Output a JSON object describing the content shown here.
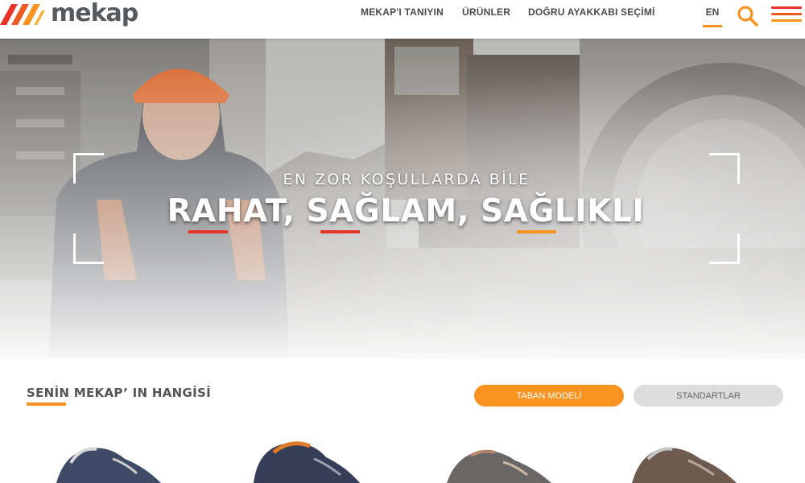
{
  "brand": {
    "name": "mekap",
    "colors": {
      "orange": "#f7931e",
      "red": "#e8332a",
      "grey": "#555a5f"
    }
  },
  "nav": {
    "items": [
      {
        "label": "MEKAP'I TANIYIN"
      },
      {
        "label": "ÜRÜNLER"
      },
      {
        "label": "DOĞRU AYAKKABI SEÇİMİ"
      }
    ],
    "language": "EN",
    "icons": {
      "search": "search-icon",
      "menu": "hamburger-menu-icon"
    }
  },
  "hero": {
    "subtitle": "EN ZOR KOŞULLARDA BİLE",
    "title": "RAHAT, SAĞLAM, SAĞLIKLI",
    "underline_colors": [
      "#e8332a",
      "#e8332a",
      "#f7931e"
    ]
  },
  "section": {
    "title": "SENİN MEKAP’ IN HANGİSİ",
    "buttons": {
      "taban": "TABAN MODELİ",
      "standartlar": "STANDARTLAR"
    },
    "products": [
      {
        "name": "shoe-navy-grey"
      },
      {
        "name": "shoe-navy-orange"
      },
      {
        "name": "shoe-grey-brown"
      },
      {
        "name": "shoe-brown-grey"
      }
    ]
  }
}
